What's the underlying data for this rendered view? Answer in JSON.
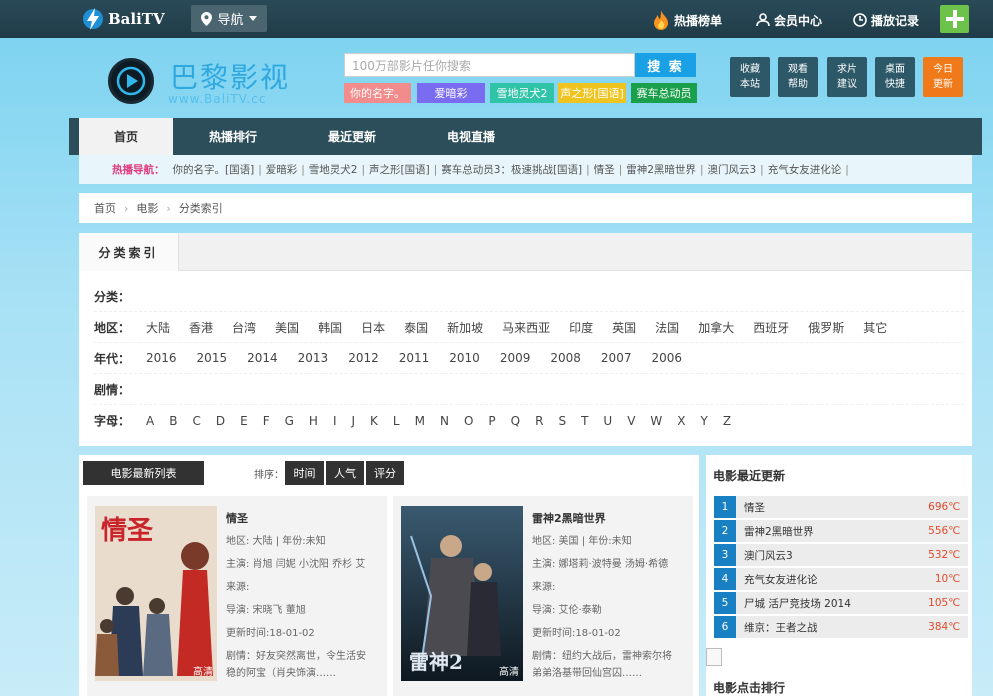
{
  "topbar": {
    "logo_text": "BaliTV",
    "nav_label": "导航",
    "hot_label": "热播榜单",
    "member_label": "会员中心",
    "history_label": "播放记录"
  },
  "header": {
    "brand_name": "巴黎影视",
    "brand_url": "www.BaliTV.cc",
    "search_placeholder": "100万部影片任你搜索",
    "search_button": "搜 索",
    "hot_tags": [
      {
        "label": "你的名字。",
        "color": "#f28b8b"
      },
      {
        "label": "爱暗彩",
        "color": "#7a6cf0"
      },
      {
        "label": "雪地灵犬2",
        "color": "#2fc4a8"
      },
      {
        "label": "声之形[国语]",
        "color": "#f0c420"
      },
      {
        "label": "赛车总动员",
        "color": "#1aa04a"
      }
    ],
    "quick_buttons": [
      {
        "line1": "收藏",
        "line2": "本站",
        "color": "#2d5868"
      },
      {
        "line1": "观看",
        "line2": "帮助",
        "color": "#2d5868"
      },
      {
        "line1": "求片",
        "line2": "建议",
        "color": "#2d5868"
      },
      {
        "line1": "桌面",
        "line2": "快捷",
        "color": "#2d5868"
      },
      {
        "line1": "今日",
        "line2": "更新",
        "color": "#f07a1a"
      }
    ]
  },
  "main_nav": {
    "tabs": [
      "首页",
      "热播排行",
      "最近更新",
      "电视直播"
    ],
    "active": "首页"
  },
  "hot_nav": {
    "label": "热播导航：",
    "items": [
      "你的名字。[国语]",
      "爱暗彩",
      "雪地灵犬2",
      "声之形[国语]",
      "赛车总动员3：极速挑战[国语]",
      "情圣",
      "雷神2黑暗世界",
      "澳门风云3",
      "充气女友进化论"
    ]
  },
  "breadcrumb": [
    "首页",
    "电影",
    "分类索引"
  ],
  "category": {
    "title": "分类索引",
    "rows": [
      {
        "key": "分类：",
        "values": []
      },
      {
        "key": "地区：",
        "values": [
          "大陆",
          "香港",
          "台湾",
          "美国",
          "韩国",
          "日本",
          "泰国",
          "新加坡",
          "马来西亚",
          "印度",
          "英国",
          "法国",
          "加拿大",
          "西班牙",
          "俄罗斯",
          "其它"
        ]
      },
      {
        "key": "年代：",
        "values": [
          "2016",
          "2015",
          "2014",
          "2013",
          "2012",
          "2011",
          "2010",
          "2009",
          "2008",
          "2007",
          "2006"
        ]
      },
      {
        "key": "剧情：",
        "values": []
      },
      {
        "key": "字母：",
        "values": [
          "A",
          "B",
          "C",
          "D",
          "E",
          "F",
          "G",
          "H",
          "I",
          "J",
          "K",
          "L",
          "M",
          "N",
          "O",
          "P",
          "Q",
          "R",
          "S",
          "T",
          "U",
          "V",
          "W",
          "X",
          "Y",
          "Z"
        ]
      }
    ]
  },
  "list": {
    "title": "电影最新列表",
    "sort_label": "排序：",
    "sort_options": [
      "时间",
      "人气",
      "评分"
    ],
    "movies": [
      {
        "title": "情圣",
        "region_year": "地区: 大陆 | 年份:未知",
        "cast": "主演: 肖旭 闫妮 小沈阳 乔杉 艾",
        "source": "来源:",
        "director": "导演: 宋晓飞 董旭",
        "updated": "更新时间:18-01-02",
        "plot": "剧情：好友突然离世，令生活安",
        "plot2": "稳的阿宝（肖央饰演……",
        "quality": "高清",
        "poster_text": "情圣"
      },
      {
        "title": "雷神2黑暗世界",
        "region_year": "地区: 美国 | 年份:未知",
        "cast": "主演: 娜塔莉·波特曼 汤姆·希德",
        "source": "来源:",
        "director": "导演: 艾伦·泰勒",
        "updated": "更新时间:18-01-02",
        "plot": "剧情：纽约大战后，雷神索尔将",
        "plot2": "弟弟洛基带回仙宫囚……",
        "quality": "高清",
        "poster_text": "雷神2"
      }
    ]
  },
  "side": {
    "title": "电影最近更新",
    "items": [
      {
        "rank": "1",
        "name": "情圣",
        "temp": "696℃"
      },
      {
        "rank": "2",
        "name": "雷神2黑暗世界",
        "temp": "556℃"
      },
      {
        "rank": "3",
        "name": "澳门风云3",
        "temp": "532℃"
      },
      {
        "rank": "4",
        "name": "充气女友进化论",
        "temp": "10℃"
      },
      {
        "rank": "5",
        "name": "尸城 活尸竞技场 2014",
        "temp": "105℃"
      },
      {
        "rank": "6",
        "name": "维京：王者之战",
        "temp": "384℃"
      }
    ],
    "title2": "电影点击排行"
  }
}
